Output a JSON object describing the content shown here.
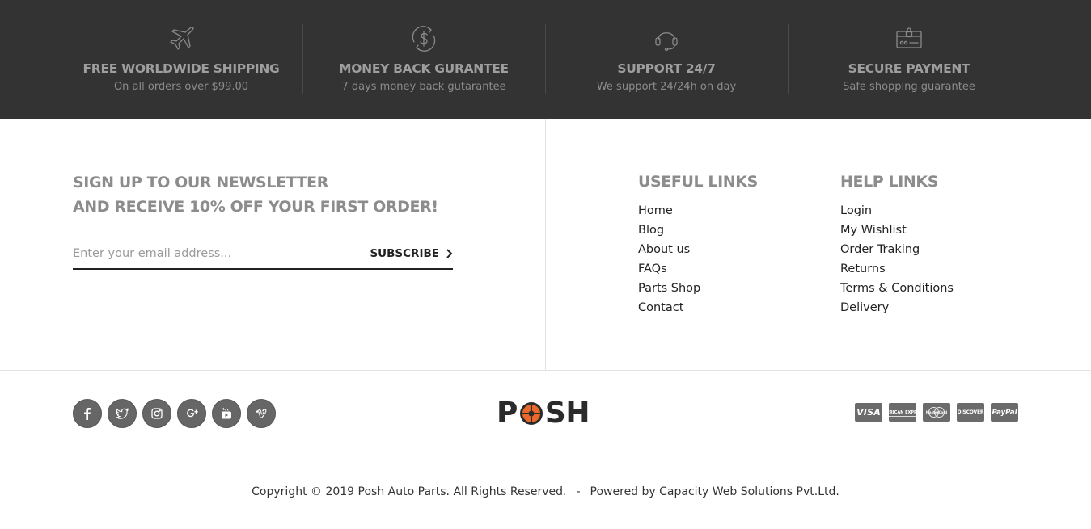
{
  "features": [
    {
      "icon": "airplane-icon",
      "title": "FREE WORLDWIDE SHIPPING",
      "subtitle": "On all orders over $99.00"
    },
    {
      "icon": "dollar-refresh-icon",
      "title": "MONEY BACK GURANTEE",
      "subtitle": "7 days money back gutarantee"
    },
    {
      "icon": "headset-icon",
      "title": "SUPPORT 24/7",
      "subtitle": "We support 24/24h on day"
    },
    {
      "icon": "secure-payment-icon",
      "title": "SECURE PAYMENT",
      "subtitle": "Safe shopping guarantee"
    }
  ],
  "newsletter": {
    "title_line1": "SIGN UP TO OUR NEWSLETTER",
    "title_line2": "AND RECEIVE 10% OFF YOUR FIRST ORDER!",
    "placeholder": "Enter your email address...",
    "button_label": "SUBSCRIBE"
  },
  "useful_links": {
    "heading": "USEFUL LINKS",
    "items": [
      "Home",
      "Blog",
      "About us",
      "FAQs",
      "Parts Shop",
      "Contact"
    ]
  },
  "help_links": {
    "heading": "HELP LINKS",
    "items": [
      "Login",
      "My Wishlist",
      "Order Traking",
      "Returns",
      "Terms & Conditions",
      "Delivery"
    ]
  },
  "social": [
    "facebook-icon",
    "twitter-icon",
    "instagram-icon",
    "google-plus-icon",
    "youtube-icon",
    "vimeo-icon"
  ],
  "logo": {
    "text_before": "P",
    "text_after": "SH",
    "accent_color": "#e9692c"
  },
  "payment_cards": [
    "VISA",
    "AMERICAN EXPRESS",
    "MasterCard",
    "DISCOVER",
    "PayPal"
  ],
  "copyright": {
    "text": "Copyright © 2019 Posh Auto Parts. All Rights Reserved.",
    "separator": "-",
    "powered": "Powered by Capacity Web Solutions Pvt.Ltd."
  },
  "colors": {
    "feature_bar_bg": "#333333",
    "heading_gray": "#8c8c8c",
    "social_bg": "#666666"
  }
}
